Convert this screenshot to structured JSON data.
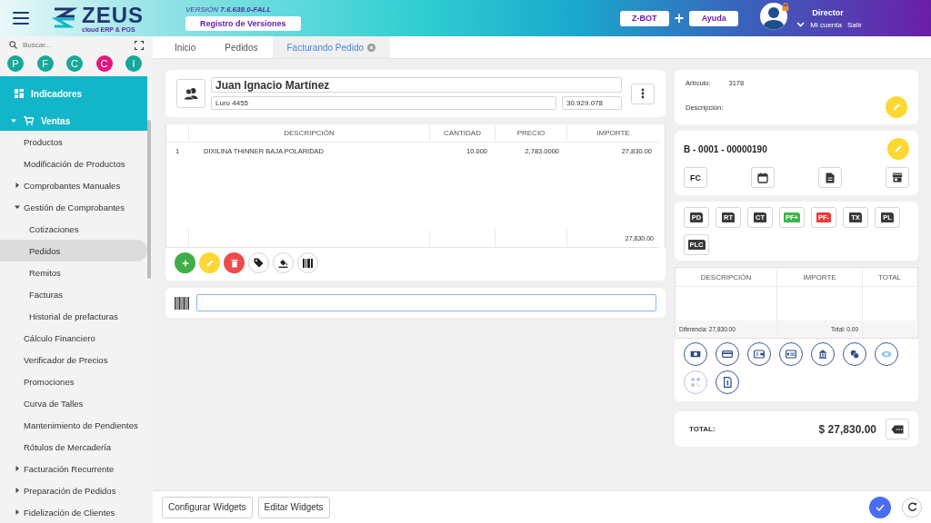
{
  "header": {
    "logo_name": "ZEUS",
    "logo_tagline": "cloud ERP & POS",
    "version": "VERSIÓN **7.6.638.0-FALL**",
    "versions_button": "Registro de Versiones",
    "bot_button": "Z-BOT",
    "plus": "+",
    "help_button": "Ayuda",
    "user": {
      "role": "Director",
      "account_link": "Mi cuenta",
      "logout_link": "Salir"
    }
  },
  "sidebar": {
    "search": {
      "placeholder": "Buscar..."
    },
    "shortcuts": [
      {
        "letter": "P",
        "color": "#17a79b"
      },
      {
        "letter": "F",
        "color": "#17a79b"
      },
      {
        "letter": "C",
        "color": "#17a79b"
      },
      {
        "letter": "C",
        "color": "#e0177c"
      },
      {
        "letter": "I",
        "color": "#17a79b"
      }
    ],
    "items": [
      {
        "label": "Indicadores",
        "kind": "link",
        "selected": false
      },
      {
        "label": "Ventas",
        "kind": "group",
        "expanded": true,
        "selected": false,
        "children": [
          {
            "label": "Productos",
            "kind": "link",
            "selected": false
          },
          {
            "label": "Modificación de Productos",
            "kind": "link",
            "selected": false
          },
          {
            "label": "Comprobantes Manuales",
            "kind": "group",
            "expanded": false,
            "selected": false
          },
          {
            "label": "Gestión de Comprobantes",
            "kind": "group",
            "expanded": true,
            "selected": false,
            "children": [
              {
                "label": "Cotizaciones",
                "kind": "link",
                "selected": false
              },
              {
                "label": "Pedidos",
                "kind": "link",
                "selected": true
              },
              {
                "label": "Remitos",
                "kind": "link",
                "selected": false
              },
              {
                "label": "Facturas",
                "kind": "link",
                "selected": false
              },
              {
                "label": "Historial de prefacturas",
                "kind": "link",
                "selected": false
              }
            ]
          },
          {
            "label": "Cálculo Financiero",
            "kind": "link",
            "selected": false
          },
          {
            "label": "Verificador de Precios",
            "kind": "link",
            "selected": false
          },
          {
            "label": "Promociones",
            "kind": "link",
            "selected": false
          },
          {
            "label": "Curva de Talles",
            "kind": "link",
            "selected": false
          },
          {
            "label": "Mantenimiento de Pendientes",
            "kind": "link",
            "selected": false
          },
          {
            "label": "Rótulos de Mercadería",
            "kind": "link",
            "selected": false
          },
          {
            "label": "Facturación Recurrente",
            "kind": "group",
            "expanded": false,
            "selected": false
          },
          {
            "label": "Preparación de Pedidos",
            "kind": "group",
            "expanded": false,
            "selected": false
          },
          {
            "label": "Fidelización de Clientes",
            "kind": "group",
            "expanded": false,
            "selected": false
          }
        ]
      }
    ]
  },
  "tabs": [
    {
      "label": "Inicio",
      "selected": false,
      "closable": false
    },
    {
      "label": "Pedidos",
      "selected": false,
      "closable": false
    },
    {
      "label": "Facturando Pedido",
      "selected": true,
      "closable": true
    }
  ],
  "customer": {
    "name": "Juan Ignacio Martínez",
    "address": "Luro 4455",
    "document": "30.929.078"
  },
  "items_table": {
    "columns": [
      "DESCRIPCIÓN",
      "CANTIDAD",
      "PRECIO",
      "IMPORTE"
    ],
    "rows": [
      {
        "number": "1",
        "description": "DIXILINA THINNER BAJA POLARIDAD",
        "quantity": "10.000",
        "price": "2,783.0000",
        "amount": "27,830.00"
      }
    ],
    "footer_total": "27,830.00"
  },
  "article": {
    "label": "Artículo:",
    "code": "3178",
    "description_label": "Descripción:"
  },
  "document": {
    "number": "B - 0001 - 00000190",
    "type_button": "FC"
  },
  "related_documents": [
    {
      "label": "PD",
      "color": "#3a3a3a"
    },
    {
      "label": "RT",
      "color": "#3a3a3a"
    },
    {
      "label": "CT",
      "color": "#3a3a3a"
    },
    {
      "label": "PF+",
      "color": "#3fb54a"
    },
    {
      "label": "PF-",
      "color": "#f0393c"
    },
    {
      "label": "TX",
      "color": "#3a3a3a"
    },
    {
      "label": "PL",
      "color": "#3a3a3a"
    },
    {
      "label": "PLC",
      "color": "#3a3a3a"
    }
  ],
  "payments": {
    "columns": [
      "DESCRIPCIÓN",
      "IMPORTE",
      "TOTAL"
    ],
    "difference": "Diferencia: 27,830.00",
    "total": "Total: 0.00",
    "methods": [
      {
        "disabled": false
      },
      {
        "disabled": false
      },
      {
        "disabled": false
      },
      {
        "disabled": false
      },
      {
        "disabled": false
      },
      {
        "disabled": false
      },
      {
        "disabled": false
      },
      {
        "disabled": true
      },
      {
        "disabled": false
      }
    ]
  },
  "total": {
    "label": "TOTAL:",
    "amount": "$ 27,830.00"
  },
  "footer": {
    "buttons": [
      "Configurar Widgets",
      "Editar Widgets"
    ]
  }
}
